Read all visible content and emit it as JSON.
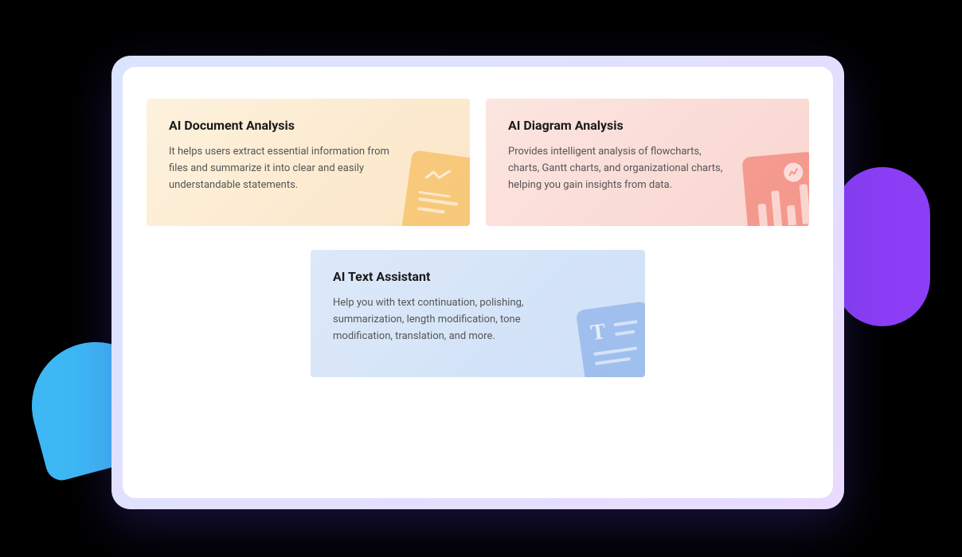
{
  "cards": [
    {
      "title": "AI Document Analysis",
      "description": "It helps users extract essential information from files and summarize it into clear and easily understandable statements."
    },
    {
      "title": "AI Diagram Analysis",
      "description": "Provides intelligent analysis of flowcharts, charts, Gantt charts, and organizational charts, helping you gain insights from data."
    },
    {
      "title": "AI Text Assistant",
      "description": "Help you with text continuation, polishing, summarization, length modification, tone modification, translation, and more."
    }
  ]
}
